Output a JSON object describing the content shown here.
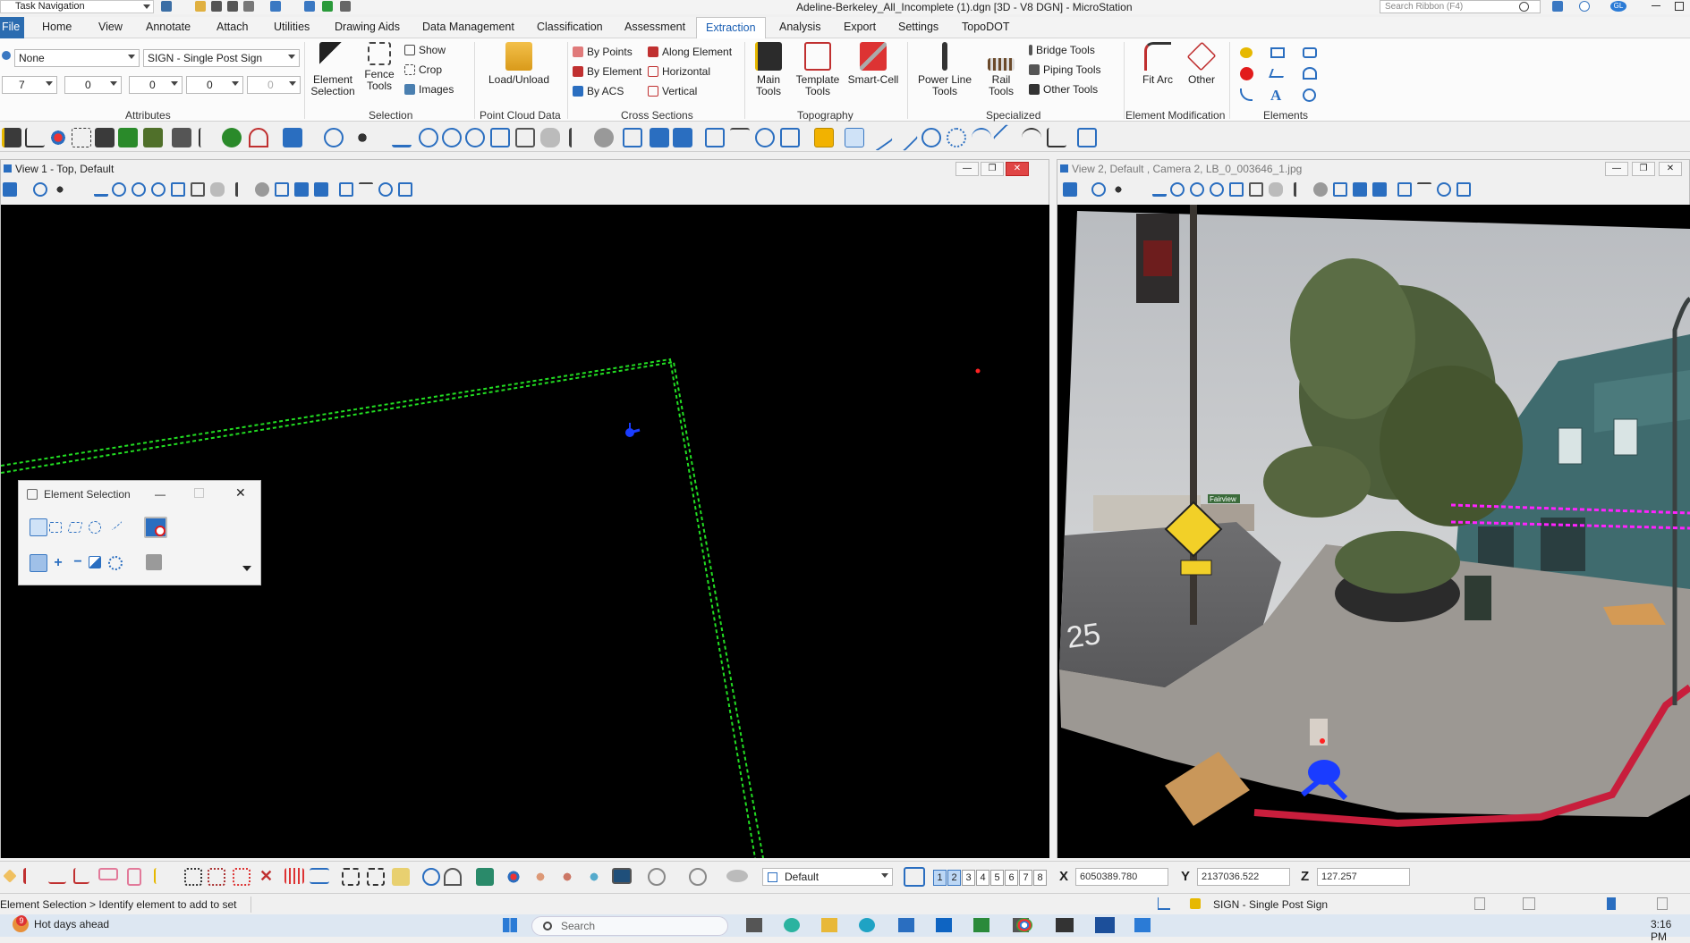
{
  "titlebar": {
    "task_navigation": "Task Navigation",
    "title": "Adeline-Berkeley_All_Incomplete (1).dgn [3D - V8 DGN] - MicroStation",
    "search_placeholder": "Search Ribbon (F4)",
    "user_initials": "GL"
  },
  "tabs": [
    "Home",
    "View",
    "Annotate",
    "Attach",
    "Utilities",
    "Drawing Aids",
    "Data Management",
    "Classification",
    "Assessment",
    "Extraction",
    "Analysis",
    "Export",
    "Settings",
    "TopoDOT"
  ],
  "file_tab": "File",
  "active_tab": "Extraction",
  "ribbon": {
    "attributes": {
      "level": "None",
      "template": "SIGN - Single Post Sign",
      "color": "7",
      "style": "0",
      "weight": "0",
      "transparency": "0",
      "priority": "0",
      "label": "Attributes"
    },
    "selection": {
      "element_selection": "Element Selection",
      "fence_tools": "Fence Tools",
      "show": "Show",
      "crop": "Crop",
      "images": "Images",
      "label": "Selection"
    },
    "point_cloud": {
      "load_unload": "Load/Unload",
      "label": "Point Cloud Data"
    },
    "cross_sections": {
      "by_points": "By Points",
      "by_element": "By Element",
      "by_acs": "By ACS",
      "along_element": "Along Element",
      "horizontal": "Horizontal",
      "vertical": "Vertical",
      "label": "Cross Sections"
    },
    "topography": {
      "main_tools": "Main Tools",
      "template_tools": "Template Tools",
      "smart_cell": "Smart-Cell",
      "label": "Topography"
    },
    "specialized": {
      "power_line_tools": "Power Line Tools",
      "rail_tools": "Rail Tools",
      "bridge_tools": "Bridge Tools",
      "piping_tools": "Piping Tools",
      "other_tools": "Other Tools",
      "label": "Specialized"
    },
    "element_modification": {
      "fit_arc": "Fit Arc",
      "other": "Other",
      "label": "Element Modification"
    },
    "elements": {
      "label": "Elements"
    }
  },
  "view1": {
    "title": "View 1 - Top, Default"
  },
  "view2": {
    "title": "View 2, Default , Camera 2, LB_0_003646_1.jpg"
  },
  "street_signs": {
    "street_name": "Fairview",
    "road_marking": "25"
  },
  "element_selection_dialog": {
    "title": "Element Selection"
  },
  "bottom_toolbar": {
    "display_style": "Default",
    "views": [
      "1",
      "2",
      "3",
      "4",
      "5",
      "6",
      "7",
      "8"
    ],
    "active_views": [
      "1",
      "2"
    ],
    "x_label": "X",
    "x_value": "6050389.780",
    "y_label": "Y",
    "y_value": "2137036.522",
    "z_label": "Z",
    "z_value": "127.257"
  },
  "status": {
    "prompt": "Element Selection > Identify element to add to set",
    "active_template": "SIGN - Single Post Sign"
  },
  "taskbar": {
    "weather_badge": "9",
    "weather_text": "Hot days ahead",
    "search_placeholder": "Search",
    "time": "3:16 PM"
  },
  "colors": {
    "accent": "#1a5fb4",
    "linework": "#22dd22",
    "edge_line": "#ff22ff",
    "marker": "#1a3cff",
    "file_tab": "#2b6cb0"
  }
}
